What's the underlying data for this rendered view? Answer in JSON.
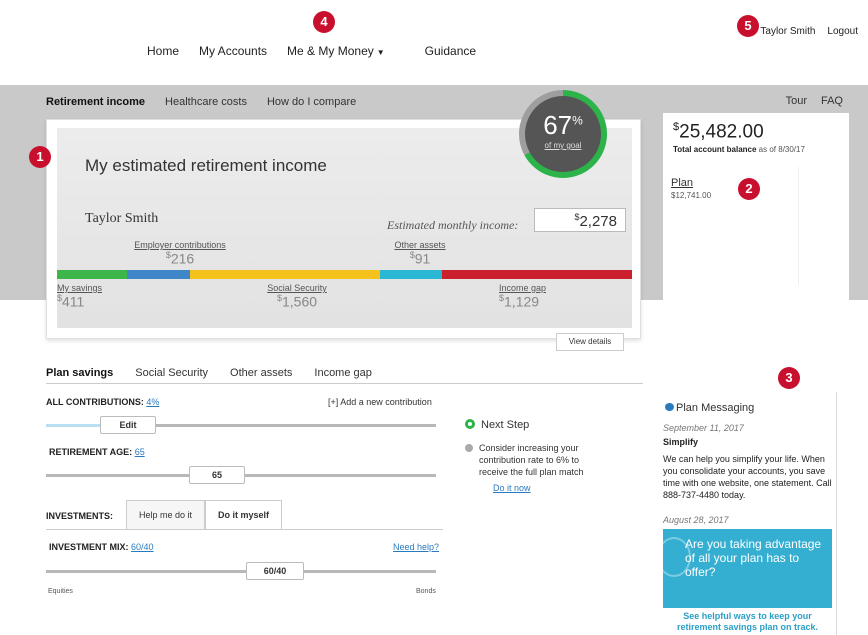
{
  "nav": {
    "items": [
      "Home",
      "My Accounts",
      "Me & My Money",
      "Guidance"
    ],
    "user": "Taylor Smith",
    "logout": "Logout"
  },
  "subtabs": [
    "Retirement income",
    "Healthcare costs",
    "How do I compare"
  ],
  "tour": "Tour",
  "faq": "FAQ",
  "estimate": {
    "title": "My estimated retirement income",
    "name": "Taylor Smith",
    "monthly_label": "Estimated monthly income:",
    "monthly_value": "2,278",
    "gauge_pct": "67",
    "gauge_sub": "of my goal",
    "employer_label": "Employer contributions",
    "employer_value": "216",
    "other_label": "Other assets",
    "other_value": "91",
    "savings_label": "My savings",
    "savings_value": "411",
    "ss_label": "Social Security",
    "ss_value": "1,560",
    "gap_label": "Income gap",
    "gap_value": "1,129",
    "view_details": "View details",
    "segment_colors": [
      "#3db54a",
      "#3f87c9",
      "#f4c21b",
      "#2ab7d3",
      "#cc1f2e"
    ]
  },
  "balance": {
    "value": "25,482.00",
    "label": "Total account balance",
    "asof": "as of 8/30/17",
    "plan_label": "Plan",
    "plan_value": "$12,741.00"
  },
  "badges": [
    "1",
    "2",
    "3",
    "4",
    "5"
  ],
  "plan_tabs": [
    "Plan savings",
    "Social Security",
    "Other assets",
    "Income gap"
  ],
  "contrib": {
    "label": "ALL CONTRIBUTIONS:",
    "pct": "4%",
    "add": "[+] Add a new contribution",
    "edit": "Edit",
    "age_label": "RETIREMENT AGE:",
    "age": "65",
    "age_btn": "65"
  },
  "investments": {
    "label": "INVESTMENTS:",
    "tab1": "Help me do it",
    "tab2": "Do it myself",
    "mix_label": "INVESTMENT MIX:",
    "mix": "60/40",
    "need_help": "Need help?",
    "mix_btn": "60/40",
    "left": "Equities",
    "right": "Bonds"
  },
  "next_step": {
    "title": "Next Step",
    "text": "Consider increasing your contribution rate to 6% to receive the full plan match",
    "link": "Do it now"
  },
  "messaging": {
    "title": "Plan Messaging",
    "date1": "September 11, 2017",
    "head1": "Simplify",
    "body1": "We can help you simplify your life. When you consolidate your accounts, you save time with one website, one statement. Call 888-737-4480 today.",
    "date2": "August 28, 2017",
    "promo": "Are you taking advantage of all your plan has to offer?",
    "promo_foot": "See helpful ways to keep your retirement savings plan on track."
  }
}
